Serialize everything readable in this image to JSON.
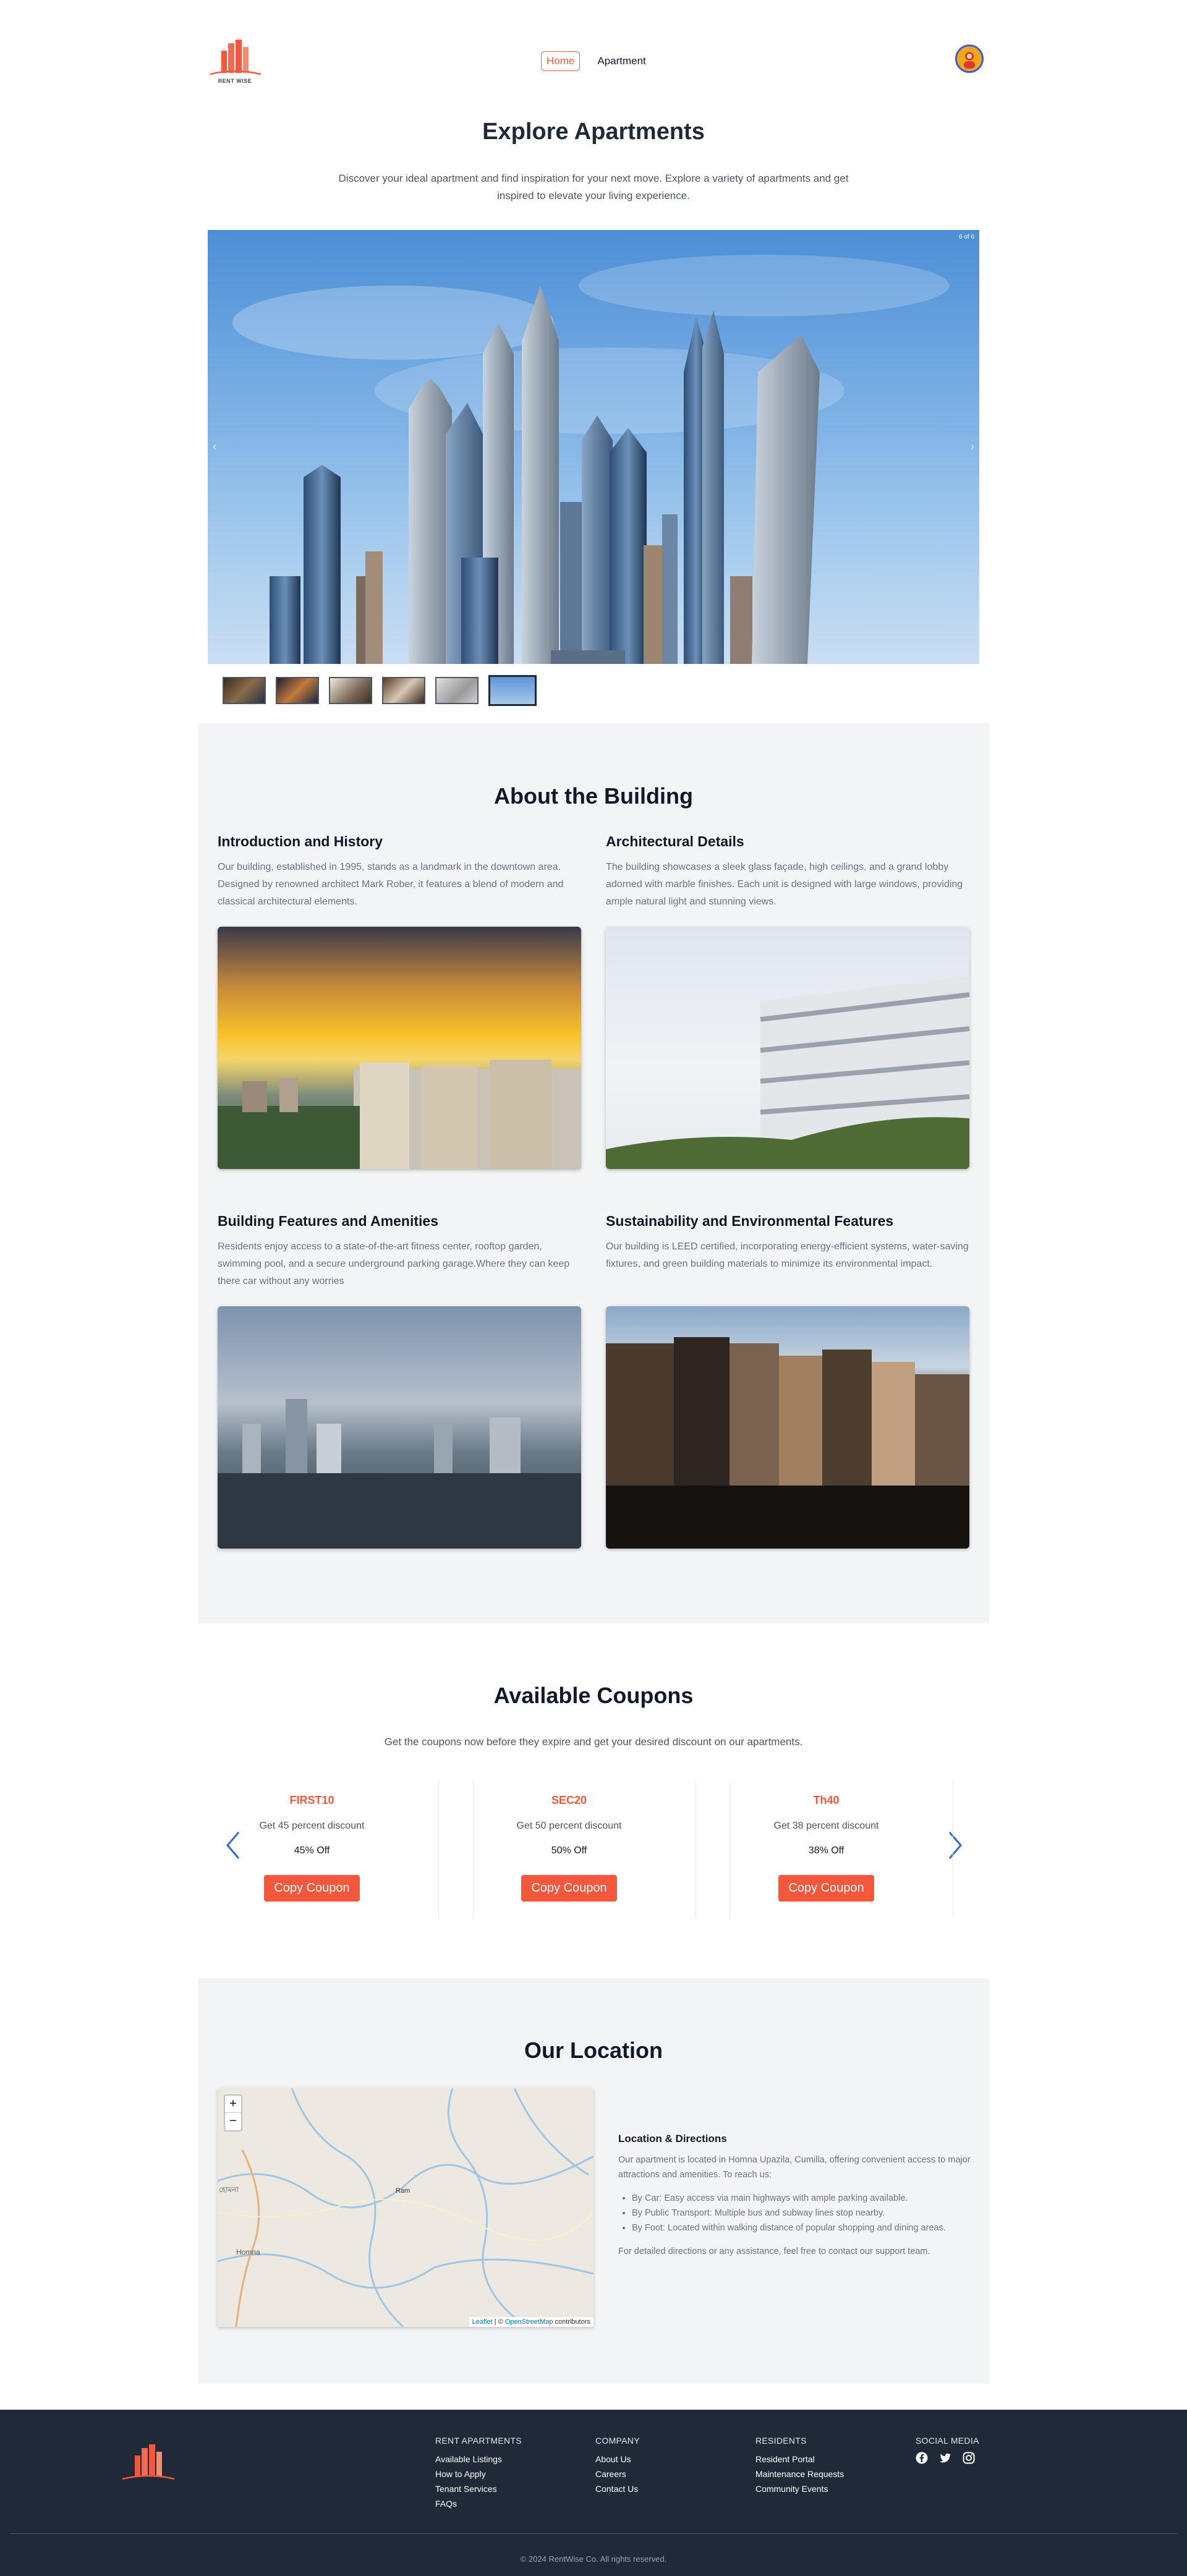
{
  "brand": {
    "name": "RENT WISE",
    "accent": "#f4573b"
  },
  "nav": {
    "items": [
      {
        "label": "Home",
        "active": true
      },
      {
        "label": "Apartment",
        "active": false
      }
    ]
  },
  "hero": {
    "title": "Explore Apartments",
    "description": "Discover your ideal apartment and find inspiration for your next move. Explore a variety of apartments and get inspired to elevate your living experience.",
    "carousel_counter": "6 of 6",
    "thumbnail_count": 6,
    "active_thumbnail": 6
  },
  "about": {
    "title": "About the Building",
    "cards": [
      {
        "heading": "Introduction and History",
        "text": "Our building, established in 1995, stands as a landmark in the downtown area. Designed by renowned architect Mark Rober, it features a blend of modern and classical architectural elements."
      },
      {
        "heading": "Architectural Details",
        "text": "The building showcases a sleek glass façade, high ceilings, and a grand lobby adorned with marble finishes. Each unit is designed with large windows, providing ample natural light and stunning views."
      },
      {
        "heading": "Building Features and Amenities",
        "text": "Residents enjoy access to a state-of-the-art fitness center, rooftop garden, swimming pool, and a secure underground parking garage.Where they can keep there car without any worries"
      },
      {
        "heading": "Sustainability and Environmental Features",
        "text": "Our building is LEED certified, incorporating energy-efficient systems, water-saving fixtures, and green building materials to minimize its environmental impact."
      }
    ]
  },
  "coupons": {
    "title": "Available Coupons",
    "description": "Get the coupons now before they expire and get your desired discount on our apartments.",
    "button_label": "Copy Coupon",
    "items": [
      {
        "code": "FIRST10",
        "desc": "Get 45 percent discount",
        "off": "45% Off"
      },
      {
        "code": "SEC20",
        "desc": "Get 50 percent discount",
        "off": "50% Off"
      },
      {
        "code": "Th40",
        "desc": "Get 38 percent discount",
        "off": "38% Off"
      }
    ]
  },
  "location": {
    "title": "Our Location",
    "map": {
      "zoom_in": "+",
      "zoom_out": "−",
      "label_1": "হোমনা",
      "label_2": "Homna",
      "label_3": "Ram",
      "attribution_leaflet": "Leaflet",
      "attribution_sep": " | © ",
      "attribution_osm": "OpenStreetMap",
      "attribution_tail": " contributors"
    },
    "heading": "Location & Directions",
    "intro": "Our apartment is located in Homna Upazila, Cumilla, offering convenient access to major attractions and amenities. To reach us:",
    "directions": [
      "By Car: Easy access via main highways with ample parking available.",
      "By Public Transport: Multiple bus and subway lines stop nearby.",
      "By Foot: Located within walking distance of popular shopping and dining areas."
    ],
    "outro": "For detailed directions or any assistance, feel free to contact our support team."
  },
  "footer": {
    "columns": [
      {
        "title": "RENT APARTMENTS",
        "links": [
          "Available Listings",
          "How to Apply",
          "Tenant Services",
          "FAQs"
        ]
      },
      {
        "title": "COMPANY",
        "links": [
          "About Us",
          "Careers",
          "Contact Us"
        ]
      },
      {
        "title": "RESIDENTS",
        "links": [
          "Resident Portal",
          "Maintenance Requests",
          "Community Events"
        ]
      }
    ],
    "social_title": "SOCIAL MEDIA",
    "social_icons": [
      "facebook-icon",
      "twitter-icon",
      "instagram-icon"
    ],
    "copyright": "© 2024 RentWise Co. All rights reserved."
  }
}
